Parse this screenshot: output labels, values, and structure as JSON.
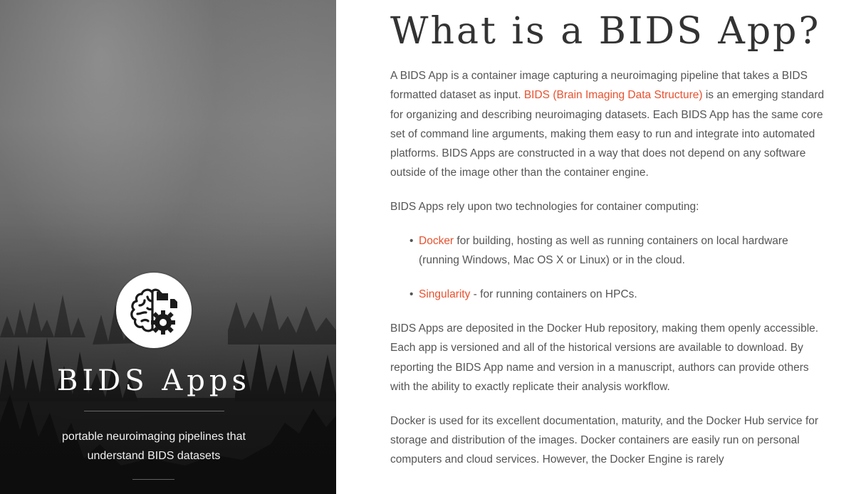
{
  "sidebar": {
    "title": "BIDS Apps",
    "tagline": "portable neuroimaging pipelines that understand BIDS datasets",
    "logo_icon": "brain-gear-icon"
  },
  "main": {
    "heading": "What is a BIDS App?",
    "p1": {
      "text_before": "A BIDS App is a container image capturing a neuroimaging pipeline that takes a BIDS formatted dataset as input. ",
      "link_text": "BIDS (Brain Imaging Data Structure)",
      "text_after": " is an emerging standard for organizing and describing neuroimaging datasets. Each BIDS App has the same core set of command line arguments, making them easy to run and integrate into automated platforms. BIDS Apps are constructed in a way that does not depend on any software outside of the image other than the container engine."
    },
    "p2": "BIDS Apps rely upon two technologies for container computing:",
    "list": [
      {
        "link_text": "Docker",
        "text": " for building, hosting as well as running containers on local hardware (running Windows, Mac OS X or Linux) or in the cloud."
      },
      {
        "link_text": "Singularity",
        "text": " - for running containers on HPCs."
      }
    ],
    "p3": "BIDS Apps are deposited in the Docker Hub repository, making them openly accessible. Each app is versioned and all of the historical versions are available to download. By reporting the BIDS App name and version in a manuscript, authors can provide others with the ability to exactly replicate their analysis workflow.",
    "p4": "Docker is used for its excellent documentation, maturity, and the Docker Hub service for storage and distribution of the images. Docker containers are easily run on personal computers and cloud services. However, the Docker Engine is rarely"
  },
  "colors": {
    "link": "#e8512f",
    "body_text": "#555555",
    "heading": "#333333"
  }
}
